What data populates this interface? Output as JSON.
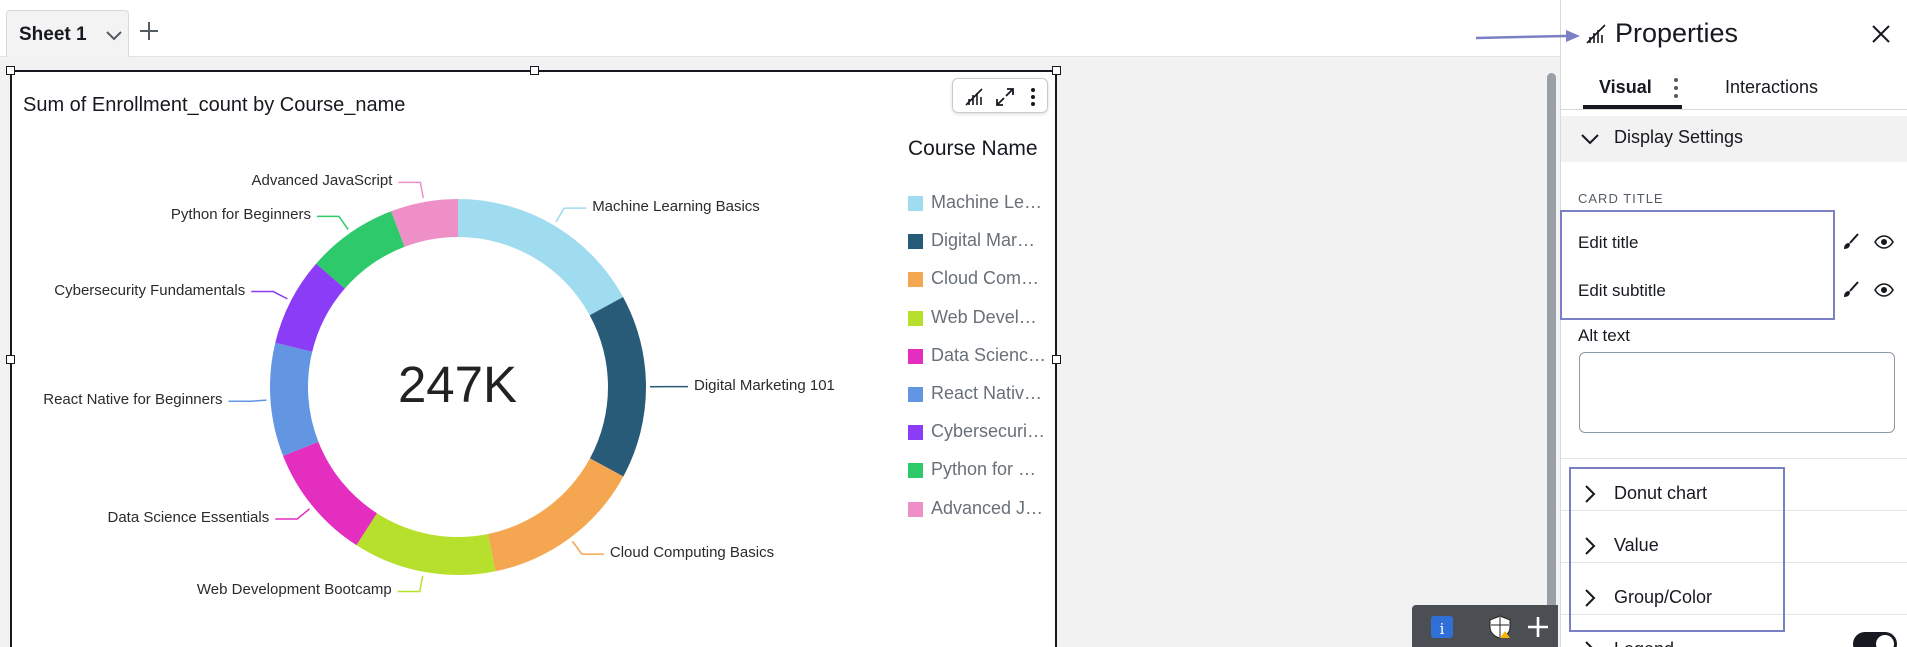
{
  "sheet_tab": {
    "label": "Sheet 1"
  },
  "visual": {
    "title": "Sum of Enrollment_count by Course_name",
    "center_value": "247K",
    "legend_title": "Course Name",
    "legend_items": [
      "Machine Le…",
      "Digital Mar…",
      "Cloud Com…",
      "Web Devel…",
      "Data Scienc…",
      "React Nativ…",
      "Cybersecuri…",
      "Python for …",
      "Advanced J…"
    ]
  },
  "chart_data": {
    "type": "pie",
    "donut": true,
    "title": "Sum of Enrollment_count by Course_name",
    "center_label": "247K",
    "legend_title": "Course Name",
    "categories": [
      "Machine Learning Basics",
      "Digital Marketing 101",
      "Cloud Computing Basics",
      "Web Development Bootcamp",
      "Data Science Essentials",
      "React Native for Beginners",
      "Cybersecurity Fundamentals",
      "Python for Beginners",
      "Advanced JavaScript"
    ],
    "values": [
      16.8,
      15.6,
      13.7,
      12.1,
      9.8,
      9.6,
      7.5,
      7.7,
      5.7
    ],
    "value_unit": "percent of total",
    "colors": [
      "#9fdcf0",
      "#285b78",
      "#f5a650",
      "#b6e02c",
      "#e32ec0",
      "#6396e2",
      "#8b3cf6",
      "#2ec96a",
      "#ef8fc8"
    ]
  },
  "properties": {
    "title": "Properties",
    "tabs": [
      "Visual",
      "Interactions"
    ],
    "section_display": "Display Settings",
    "card_title_caption": "CARD TITLE",
    "edit_title": "Edit title",
    "edit_subtitle": "Edit subtitle",
    "alt_text_label": "Alt text",
    "collapsibles": [
      "Donut chart",
      "Value",
      "Group/Color",
      "Legend"
    ]
  },
  "colors": {
    "accent": "#7b7fc4",
    "tab_active": "#16191f"
  }
}
